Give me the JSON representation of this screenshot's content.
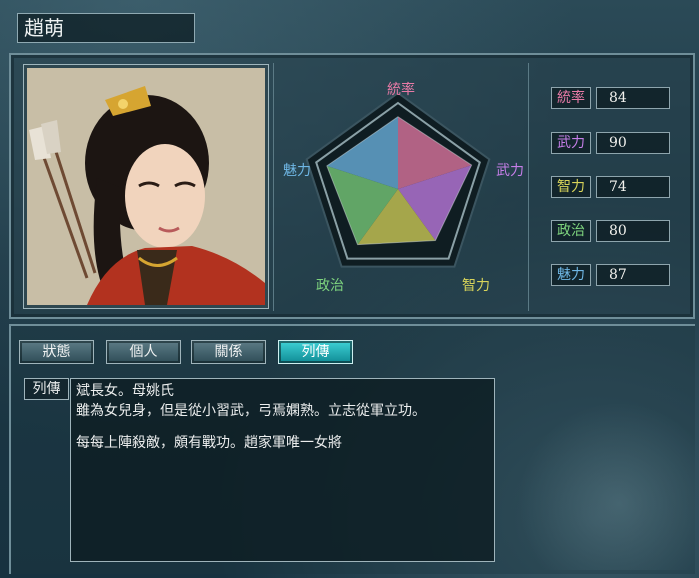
{
  "character": {
    "name": "趙萌"
  },
  "radar": {
    "labels": [
      {
        "text": "統率",
        "color": "#e87aa6"
      },
      {
        "text": "武力",
        "color": "#c57ee8"
      },
      {
        "text": "智力",
        "color": "#d8d45a"
      },
      {
        "text": "政治",
        "color": "#7ed37e"
      },
      {
        "text": "魅力",
        "color": "#6fb7e5"
      }
    ],
    "max": 100
  },
  "stats": [
    {
      "label": "統率",
      "value": "84",
      "color": "#e87aa6"
    },
    {
      "label": "武力",
      "value": "90",
      "color": "#c57ee8"
    },
    {
      "label": "智力",
      "value": "74",
      "color": "#d8d45a"
    },
    {
      "label": "政治",
      "value": "80",
      "color": "#7ed37e"
    },
    {
      "label": "魅力",
      "value": "87",
      "color": "#6fb7e5"
    }
  ],
  "tabs": [
    {
      "label": "狀態",
      "active": false
    },
    {
      "label": "個人",
      "active": false
    },
    {
      "label": "關係",
      "active": false
    },
    {
      "label": "列傳",
      "active": true
    }
  ],
  "biography": {
    "tag": "列傳",
    "lines": [
      "斌長女。母姚氏",
      "雖為女兒身，但是從小習武，弓焉嫻熟。立志從軍立功。",
      "",
      "每每上陣殺敵，頗有戰功。趙家軍唯一女將"
    ]
  }
}
